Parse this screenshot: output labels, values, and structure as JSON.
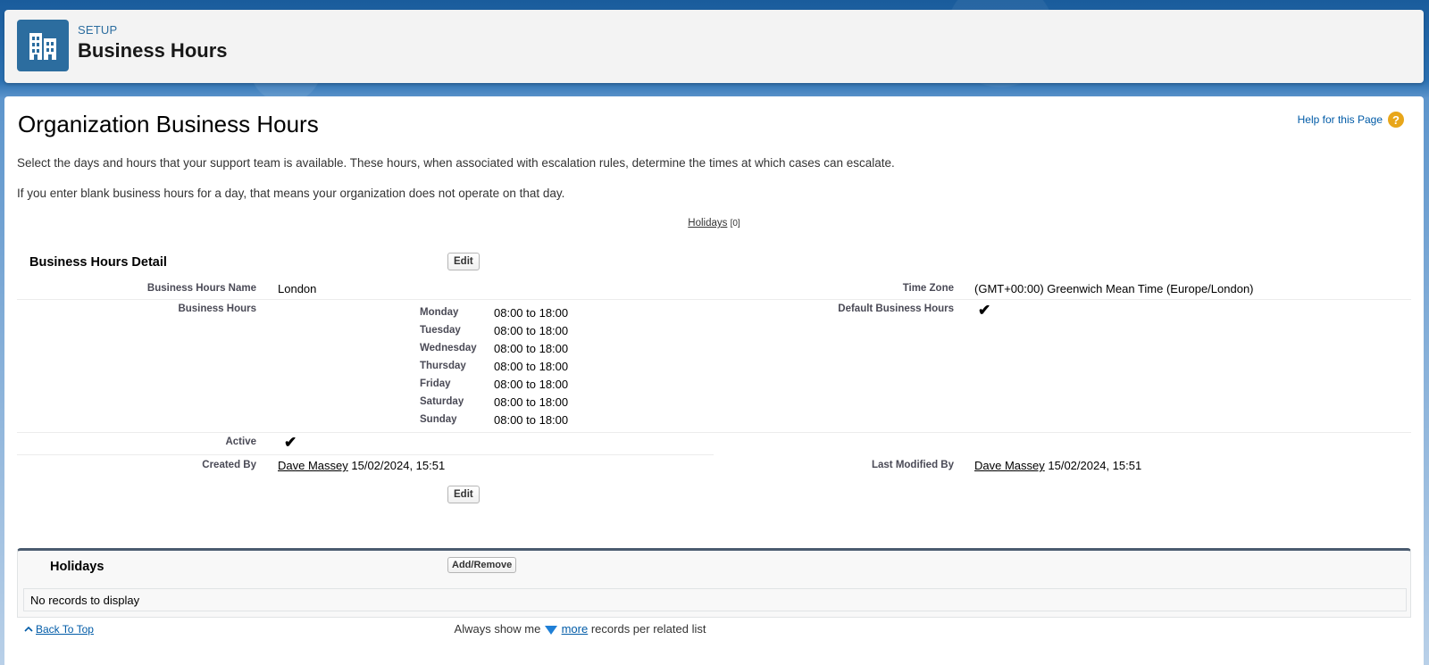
{
  "header": {
    "setup_label": "SETUP",
    "title": "Business Hours",
    "icon": "building-icon"
  },
  "page": {
    "title": "Organization Business Hours",
    "help_label": "Help for this Page",
    "description_1": "Select the days and hours that your support team is available. These hours, when associated with escalation rules, determine the times at which cases can escalate.",
    "description_2": "If you enter blank business hours for a day, that means your organization does not operate on that day.",
    "holidays_link": "Holidays",
    "holidays_count": "[0]"
  },
  "detail": {
    "section_title": "Business Hours Detail",
    "edit_label": "Edit",
    "fields": {
      "name_label": "Business Hours Name",
      "name_value": "London",
      "timezone_label": "Time Zone",
      "timezone_value": "(GMT+00:00) Greenwich Mean Time (Europe/London)",
      "hours_label": "Business Hours",
      "default_label": "Default Business Hours",
      "active_label": "Active",
      "created_label": "Created By",
      "created_user": "Dave Massey",
      "created_date": "15/02/2024, 15:51",
      "modified_label": "Last Modified By",
      "modified_user": "Dave Massey",
      "modified_date": "15/02/2024, 15:51"
    },
    "days": [
      {
        "day": "Monday",
        "hours": "08:00 to 18:00"
      },
      {
        "day": "Tuesday",
        "hours": "08:00 to 18:00"
      },
      {
        "day": "Wednesday",
        "hours": "08:00 to 18:00"
      },
      {
        "day": "Thursday",
        "hours": "08:00 to 18:00"
      },
      {
        "day": "Friday",
        "hours": "08:00 to 18:00"
      },
      {
        "day": "Saturday",
        "hours": "08:00 to 18:00"
      },
      {
        "day": "Sunday",
        "hours": "08:00 to 18:00"
      }
    ],
    "check_glyph": "✔"
  },
  "holidays_list": {
    "title": "Holidays",
    "add_remove_label": "Add/Remove",
    "empty_text": "No records to display"
  },
  "footer": {
    "back_to_top": "Back To Top",
    "always_show_prefix": "Always show me",
    "more_label": "more",
    "always_show_suffix": "records per related list"
  },
  "colors": {
    "link": "#015ba7",
    "header_icon_bg": "#2c6d9f",
    "help_icon_bg": "#e8a61a"
  }
}
